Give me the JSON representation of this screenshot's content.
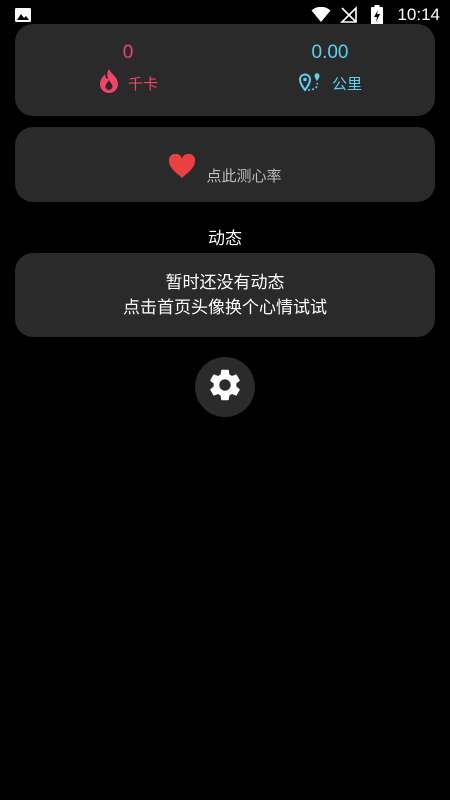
{
  "status_bar": {
    "time": "10:14",
    "icons": [
      "image-icon",
      "wifi-icon",
      "no-signal-icon",
      "battery-charging-icon"
    ]
  },
  "stats": {
    "calories": {
      "value": "0",
      "label": "千卡",
      "icon": "fire-icon",
      "color": "#f0446a"
    },
    "distance": {
      "value": "0.00",
      "label": "公里",
      "icon": "location-route-icon",
      "color": "#5ad0f0"
    }
  },
  "heart_rate": {
    "label": "点此测心率",
    "icon": "heart-icon",
    "icon_color": "#e8413f"
  },
  "dynamics": {
    "title": "动态",
    "empty_line1": "暂时还没有动态",
    "empty_line2": "点击首页头像换个心情试试"
  },
  "settings": {
    "icon": "gear-icon"
  },
  "colors": {
    "background": "#000000",
    "card": "#2a2a2a",
    "calorie_accent": "#f0446a",
    "distance_accent": "#5ad0f0"
  }
}
